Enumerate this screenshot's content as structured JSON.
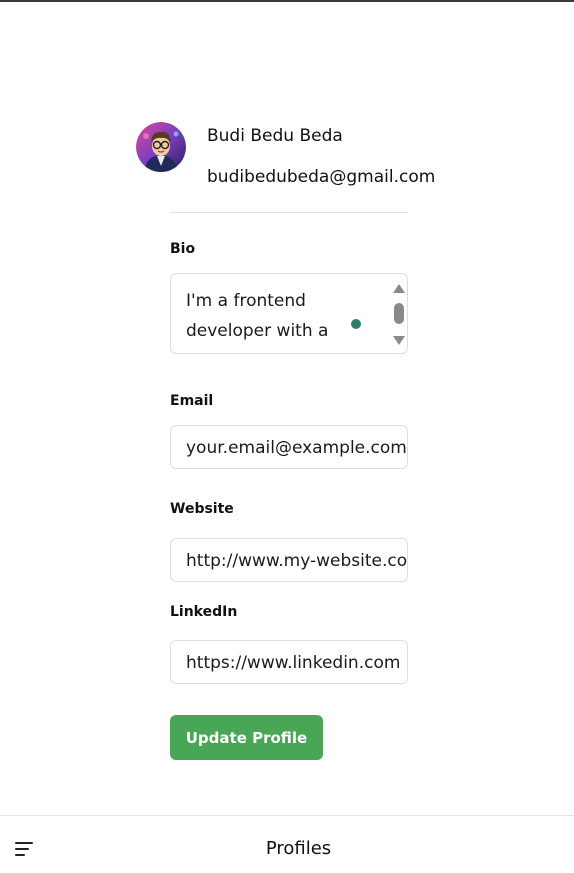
{
  "profile": {
    "name": "Budi Bedu Beda",
    "email": "budibedubeda@gmail.com",
    "avatar_icon": "cartoon-avatar-icon"
  },
  "form": {
    "bio": {
      "label": "Bio",
      "value": "I'm a frontend developer with a passion for building"
    },
    "email": {
      "label": "Email",
      "value": "your.email@example.com"
    },
    "website": {
      "label": "Website",
      "value": "http://www.my-website.com"
    },
    "linkedin": {
      "label": "LinkedIn",
      "value": "https://www.linkedin.com"
    },
    "submit_label": "Update Profile"
  },
  "bottom_bar": {
    "title": "Profiles",
    "menu_icon": "hamburger-menu-icon"
  },
  "colors": {
    "accent": "#4aa657",
    "cursor_dot": "#2e7d6b"
  }
}
